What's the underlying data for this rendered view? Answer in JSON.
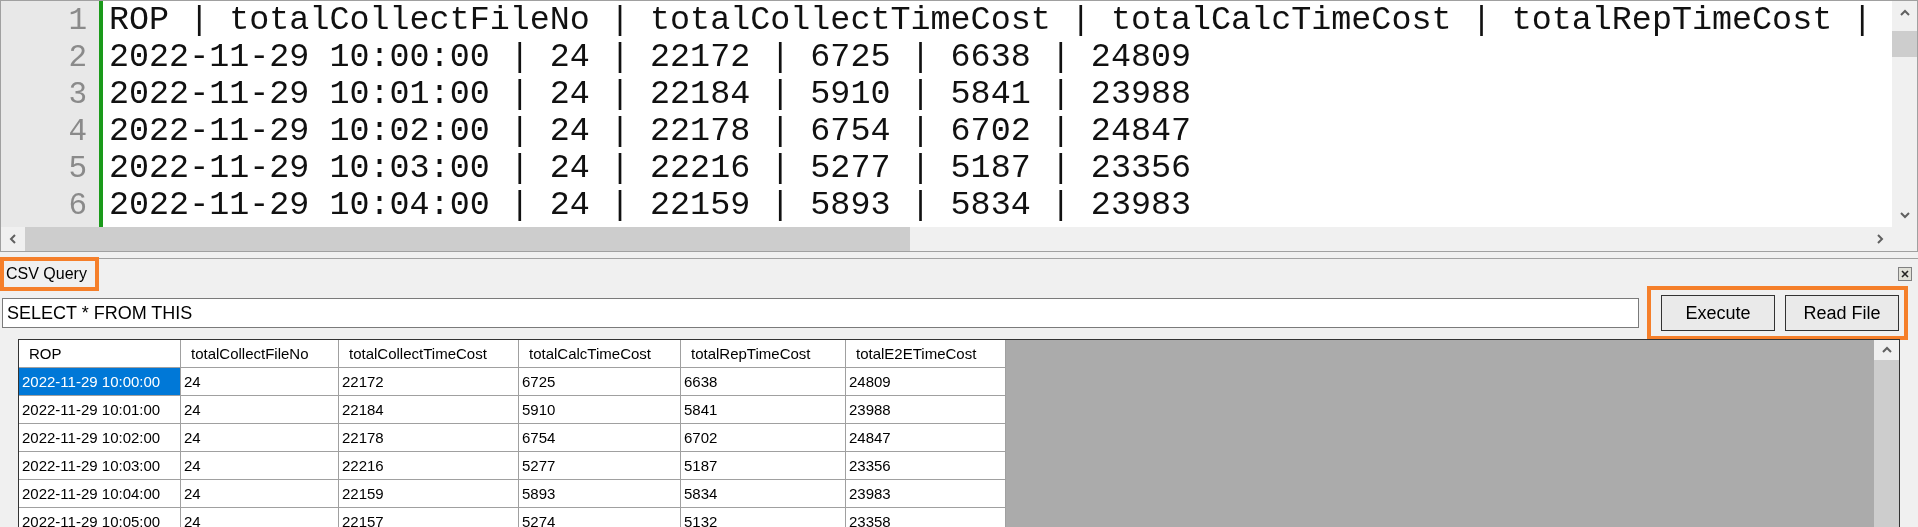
{
  "editor": {
    "lines": [
      {
        "number": "1",
        "text": "ROP | totalCollectFileNo | totalCollectTimeCost | totalCalcTimeCost | totalRepTimeCost |"
      },
      {
        "number": "2",
        "text": "2022-11-29 10:00:00 | 24 | 22172 | 6725 | 6638 | 24809"
      },
      {
        "number": "3",
        "text": "2022-11-29 10:01:00 | 24 | 22184 | 5910 | 5841 | 23988"
      },
      {
        "number": "4",
        "text": "2022-11-29 10:02:00 | 24 | 22178 | 6754 | 6702 | 24847"
      },
      {
        "number": "5",
        "text": "2022-11-29 10:03:00 | 24 | 22216 | 5277 | 5187 | 23356"
      },
      {
        "number": "6",
        "text": "2022-11-29 10:04:00 | 24 | 22159 | 5893 | 5834 | 23983"
      }
    ]
  },
  "panel": {
    "title": "CSV Query",
    "title_highlighted": true,
    "query": "SELECT * FROM THIS",
    "buttons": [
      "Execute",
      "Read File"
    ],
    "buttons_highlighted": true,
    "table": {
      "columns": [
        "ROP",
        "totalCollectFileNo",
        "totalCollectTimeCost",
        "totalCalcTimeCost",
        "totalRepTimeCost",
        "totalE2ETimeCost"
      ],
      "rows": [
        {
          "cells": [
            "2022-11-29 10:00:00",
            "24",
            "22172",
            "6725",
            "6638",
            "24809"
          ],
          "selected": true
        },
        {
          "cells": [
            "2022-11-29 10:01:00",
            "24",
            "22184",
            "5910",
            "5841",
            "23988"
          ],
          "selected": false
        },
        {
          "cells": [
            "2022-11-29 10:02:00",
            "24",
            "22178",
            "6754",
            "6702",
            "24847"
          ],
          "selected": false
        },
        {
          "cells": [
            "2022-11-29 10:03:00",
            "24",
            "22216",
            "5277",
            "5187",
            "23356"
          ],
          "selected": false
        },
        {
          "cells": [
            "2022-11-29 10:04:00",
            "24",
            "22159",
            "5893",
            "5834",
            "23983"
          ],
          "selected": false
        },
        {
          "cells": [
            "2022-11-29 10:05:00",
            "24",
            "22157",
            "5274",
            "5132",
            "23358"
          ],
          "selected": false
        }
      ]
    }
  }
}
